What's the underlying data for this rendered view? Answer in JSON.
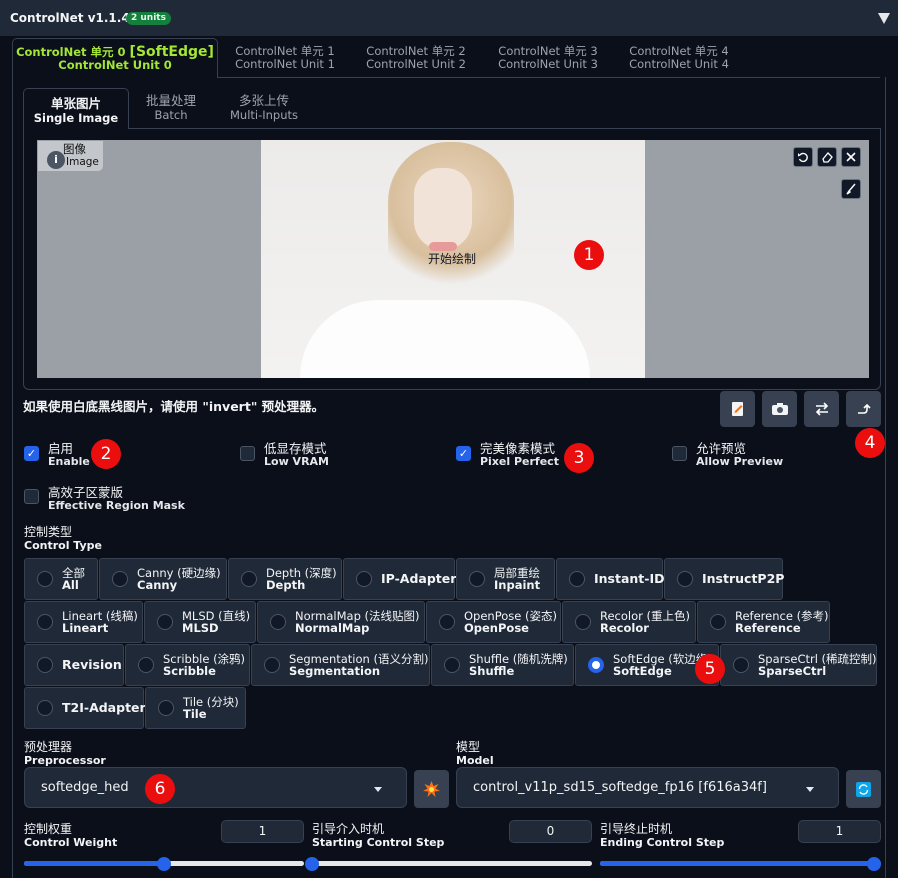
{
  "header": {
    "title": "ControlNet v1.1.449",
    "units_badge": "2 units"
  },
  "unit_tabs": [
    {
      "l1_prefix": "ControlNet 单元 0",
      "l1_suffix": "[SoftEdge]",
      "l2": "ControlNet Unit 0"
    },
    {
      "l1": "ControlNet 单元 1",
      "l2": "ControlNet Unit 1"
    },
    {
      "l1": "ControlNet 单元 2",
      "l2": "ControlNet Unit 2"
    },
    {
      "l1": "ControlNet 单元 3",
      "l2": "ControlNet Unit 3"
    },
    {
      "l1": "ControlNet 单元 4",
      "l2": "ControlNet Unit 4"
    }
  ],
  "input_tabs": [
    {
      "l1": "单张图片",
      "l2": "Single Image"
    },
    {
      "l1": "批量处理",
      "l2": "Batch"
    },
    {
      "l1": "多张上传",
      "l2": "Multi-Inputs"
    }
  ],
  "image": {
    "label_zh": "图像",
    "label_en": "Image",
    "label_icon": "i",
    "overlay_text": "开始绘制",
    "icons": [
      "undo-icon",
      "eraser-icon",
      "close-icon",
      "brush-icon"
    ]
  },
  "hint": "如果使用白底黑线图片，请使用 \"invert\" 预处理器。",
  "tool_icons": [
    "edit-icon",
    "camera-icon",
    "swap-icon",
    "send-icon"
  ],
  "badges": [
    "1",
    "2",
    "3",
    "4",
    "5",
    "6"
  ],
  "checkboxes": [
    {
      "zh": "启用",
      "en": "Enable",
      "checked": true
    },
    {
      "zh": "低显存模式",
      "en": "Low VRAM",
      "checked": false
    },
    {
      "zh": "完美像素模式",
      "en": "Pixel Perfect",
      "checked": true
    },
    {
      "zh": "允许预览",
      "en": "Allow Preview",
      "checked": false
    },
    {
      "zh": "高效子区蒙版",
      "en": "Effective Region Mask",
      "checked": false
    }
  ],
  "control_type": {
    "zh": "控制类型",
    "en": "Control Type"
  },
  "control_options": [
    {
      "zh": "全部",
      "en": "All"
    },
    {
      "zh": "Canny (硬边缘)",
      "en": "Canny"
    },
    {
      "zh": "Depth (深度)",
      "en": "Depth"
    },
    {
      "one": "IP-Adapter"
    },
    {
      "zh": "局部重绘",
      "en": "Inpaint"
    },
    {
      "one": "Instant-ID"
    },
    {
      "one": "InstructP2P"
    },
    {
      "zh": "Lineart (线稿)",
      "en": "Lineart"
    },
    {
      "zh": "MLSD (直线)",
      "en": "MLSD"
    },
    {
      "zh": "NormalMap (法线贴图)",
      "en": "NormalMap"
    },
    {
      "zh": "OpenPose (姿态)",
      "en": "OpenPose"
    },
    {
      "zh": "Recolor (重上色)",
      "en": "Recolor"
    },
    {
      "zh": "Reference (参考)",
      "en": "Reference"
    },
    {
      "one": "Revision"
    },
    {
      "zh": "Scribble (涂鸦)",
      "en": "Scribble"
    },
    {
      "zh": "Segmentation (语义分割)",
      "en": "Segmentation"
    },
    {
      "zh": "Shuffle (随机洗牌)",
      "en": "Shuffle"
    },
    {
      "zh": "SoftEdge (软边缘)",
      "en": "SoftEdge",
      "selected": true
    },
    {
      "zh": "SparseCtrl (稀疏控制)",
      "en": "SparseCtrl"
    },
    {
      "one": "T2I-Adapter"
    },
    {
      "zh": "Tile (分块)",
      "en": "Tile"
    }
  ],
  "preprocessor": {
    "zh": "预处理器",
    "en": "Preprocessor",
    "value": "softedge_hed",
    "run_icon": "explosion-icon"
  },
  "model": {
    "zh": "模型",
    "en": "Model",
    "value": "control_v11p_sd15_softedge_fp16 [f616a34f]",
    "refresh_icon": "refresh-icon"
  },
  "sliders": [
    {
      "zh": "控制权重",
      "en": "Control Weight",
      "value": "1",
      "fraction": 0.5
    },
    {
      "zh": "引导介入时机",
      "en": "Starting Control Step",
      "value": "0",
      "fraction": 0.0
    },
    {
      "zh": "引导终止时机",
      "en": "Ending Control Step",
      "value": "1",
      "fraction": 1.0
    }
  ],
  "colors": {
    "accent": "#2563eb",
    "active_tab": "#a3e635",
    "badge_red": "#ea0e0e",
    "units_green": "#15803d"
  }
}
